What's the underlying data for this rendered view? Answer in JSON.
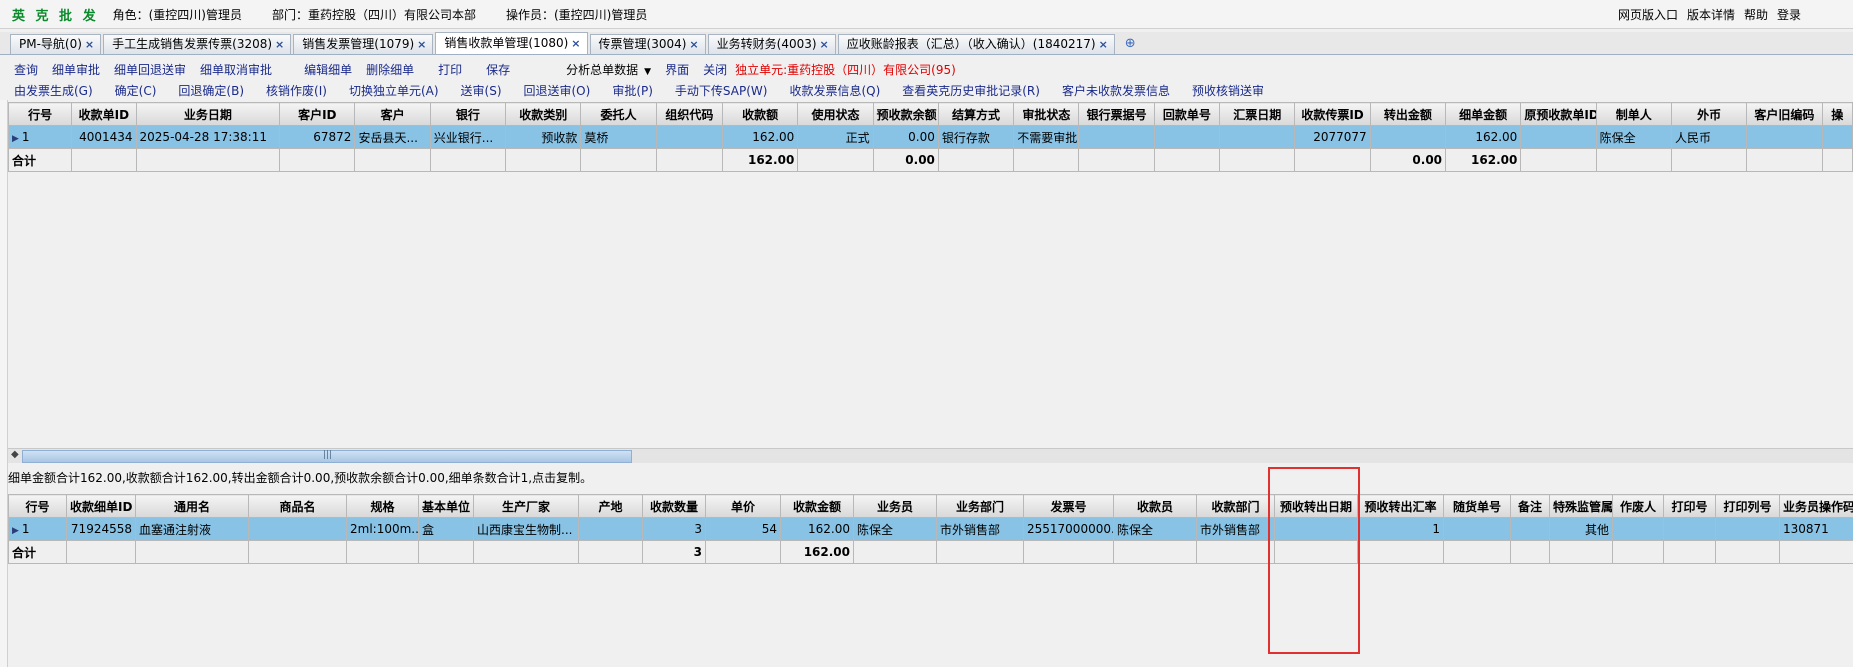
{
  "topbar": {
    "brand": "英 克 批 发",
    "role": "角色：(重控四川)管理员",
    "dept": "部门：重药控股（四川）有限公司本部",
    "operator": "操作员：(重控四川)管理员",
    "links": [
      "网页版入口",
      "版本详情",
      "帮助",
      "登录"
    ]
  },
  "tabs": [
    {
      "label": "PM-导航(0)",
      "active": false
    },
    {
      "label": "手工生成销售发票传票(3208)",
      "active": false
    },
    {
      "label": "销售发票管理(1079)",
      "active": false
    },
    {
      "label": "销售收款单管理(1080)",
      "active": true
    },
    {
      "label": "传票管理(3004)",
      "active": false
    },
    {
      "label": "业务转财务(4003)",
      "active": false
    },
    {
      "label": "应收账龄报表（汇总）（收入确认）(1840217)",
      "active": false
    }
  ],
  "tab_close": "×",
  "tab_add": "⊕",
  "toolbar1": {
    "buttons": [
      "查询",
      "细单审批",
      "细单回退送审",
      "细单取消审批",
      "编辑细单",
      "删除细单",
      "打印",
      "保存"
    ],
    "dropdown": "分析总单数据",
    "buttons2": [
      "界面",
      "关闭"
    ],
    "unit": "独立单元:重药控股（四川）有限公司(95)"
  },
  "toolbar2": {
    "buttons": [
      "由发票生成(G)",
      "确定(C)",
      "回退确定(B)",
      "核销作废(I)",
      "切换独立单元(A)",
      "送审(S)",
      "回退送审(O)",
      "审批(P)",
      "手动下传SAP(W)",
      "收款发票信息(Q)",
      "查看英克历史审批记录(R)",
      "客户未收款发票信息",
      "预收核销送审"
    ]
  },
  "main_table": {
    "headers": [
      "行号",
      "收款单ID",
      "业务日期",
      "客户ID",
      "客户",
      "银行",
      "收款类别",
      "委托人",
      "组织代码",
      "收款额",
      "使用状态",
      "预收款余额",
      "结算方式",
      "审批状态",
      "银行票据号",
      "回款单号",
      "汇票日期",
      "收款传票ID",
      "转出金额",
      "细单金额",
      "原预收款单ID",
      "制单人",
      "外币",
      "客户旧编码",
      "操"
    ],
    "row": [
      "1",
      "4001434",
      "2025-04-28 17:38:11",
      "67872",
      "安岳县天...",
      "兴业银行...",
      "预收款",
      "莫桥",
      "",
      "162.00",
      "正式",
      "0.00",
      "银行存款",
      "不需要审批",
      "",
      "",
      "",
      "2077077",
      "",
      "162.00",
      "",
      "陈保全",
      "人民币",
      "",
      ""
    ],
    "sum": [
      "合计",
      "",
      "",
      "",
      "",
      "",
      "",
      "",
      "",
      "162.00",
      "",
      "0.00",
      "",
      "",
      "",
      "",
      "",
      "",
      "0.00",
      "162.00",
      "",
      "",
      "",
      "",
      ""
    ]
  },
  "status_text": "细单金额合计162.00,收款额合计162.00,转出金额合计0.00,预收款余额合计0.00,细单条数合计1,点击复制。",
  "detail_table": {
    "headers": [
      "行号",
      "收款细单ID",
      "通用名",
      "商品名",
      "规格",
      "基本单位",
      "生产厂家",
      "产地",
      "收款数量",
      "单价",
      "收款金额",
      "业务员",
      "业务部门",
      "发票号",
      "收款员",
      "收款部门",
      "预收转出日期",
      "预收转出汇率",
      "随货单号",
      "备注",
      "特殊监管属性",
      "作废人",
      "打印号",
      "打印列号",
      "业务员操作码"
    ],
    "row": [
      "1",
      "71924558",
      "血塞通注射液",
      "",
      "2ml:100m...",
      "盒",
      "山西康宝生物制...",
      "",
      "3",
      "54",
      "162.00",
      "陈保全",
      "市外销售部",
      "25517000000...",
      "陈保全",
      "市外销售部",
      "",
      "1",
      "",
      "",
      "其他",
      "",
      "",
      "",
      "130871"
    ],
    "sum": [
      "合计",
      "",
      "",
      "",
      "",
      "",
      "",
      "",
      "3",
      "",
      "162.00",
      "",
      "",
      "",
      "",
      "",
      "",
      "",
      "",
      "",
      "",
      "",
      "",
      "",
      ""
    ]
  }
}
